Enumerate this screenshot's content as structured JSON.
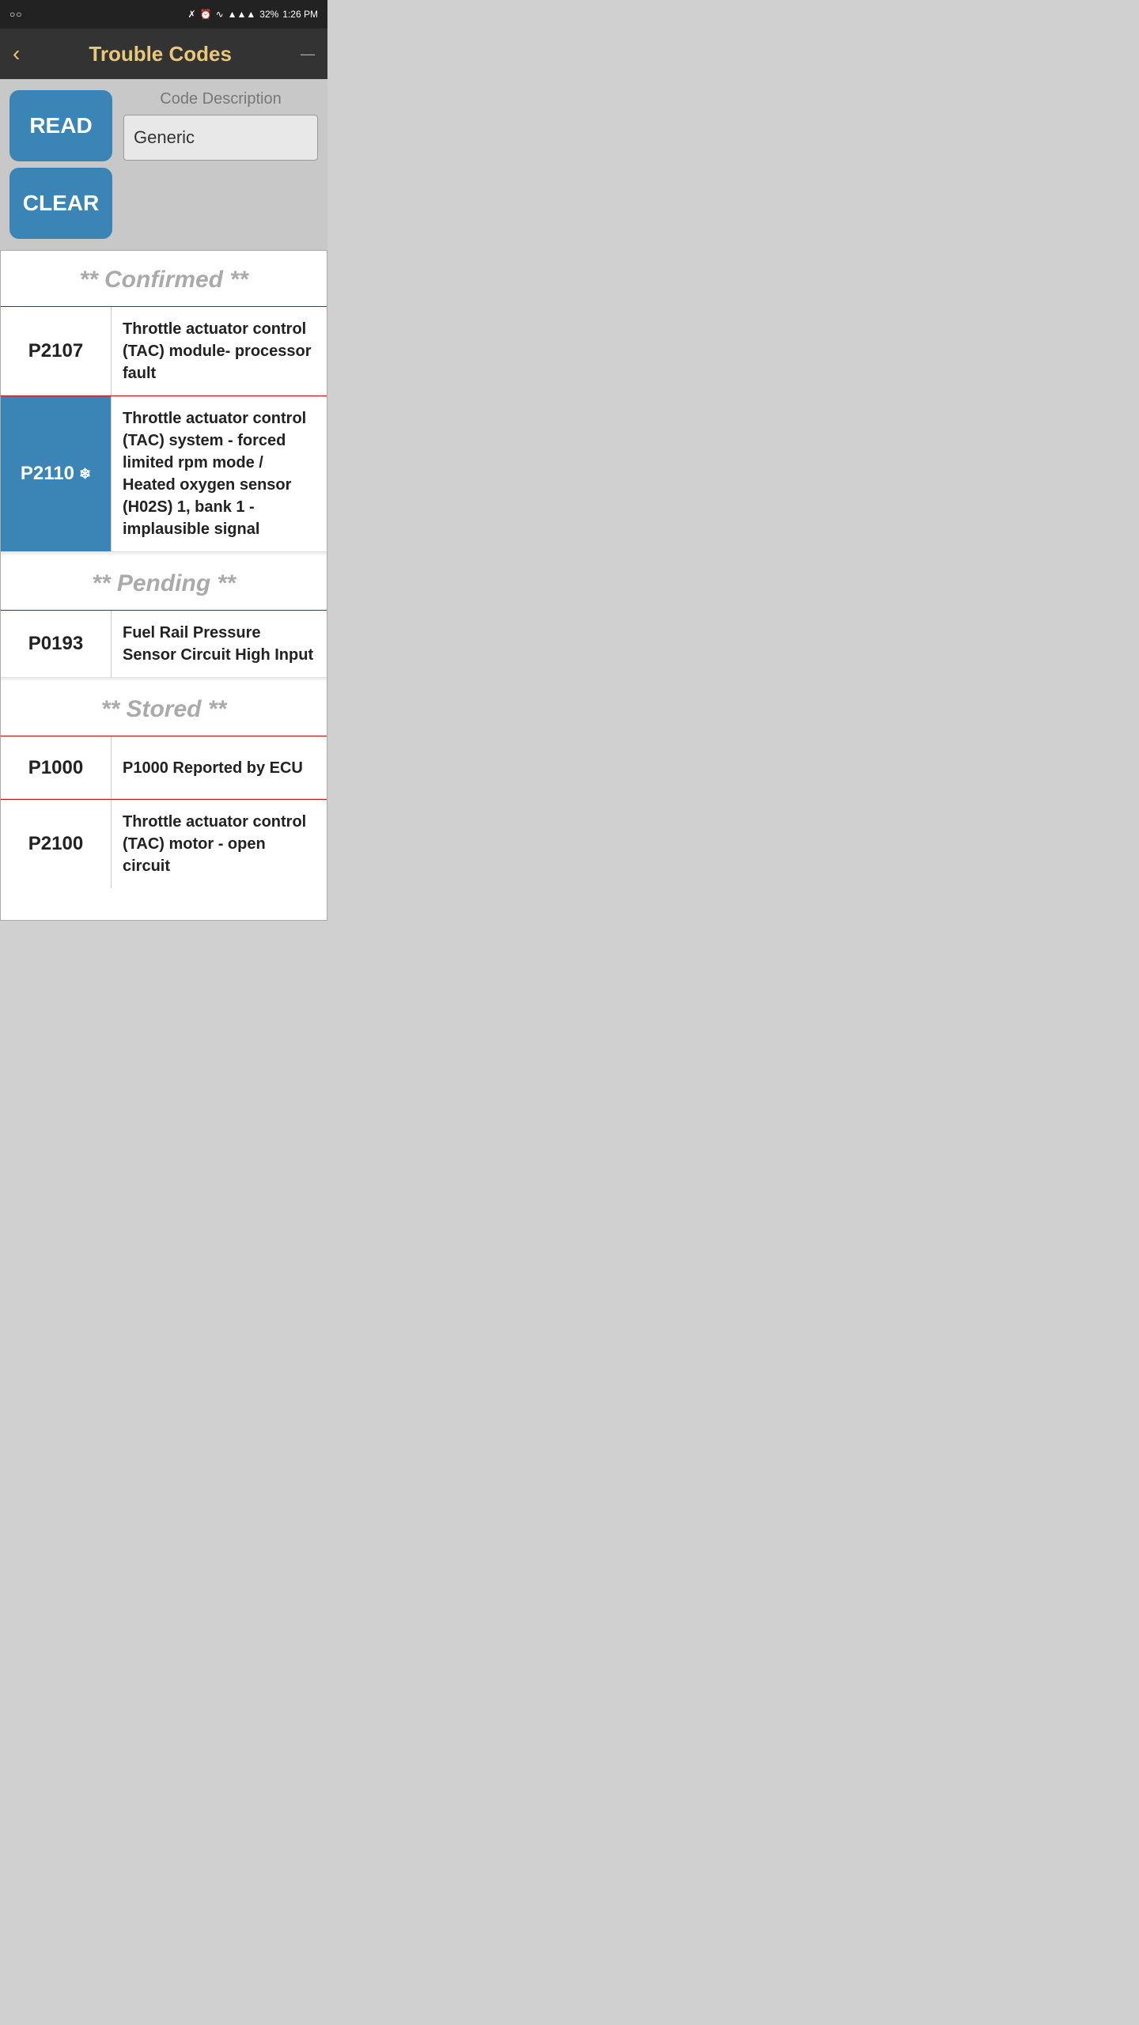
{
  "statusBar": {
    "leftIcon": "○○",
    "bluetooth": "⚇",
    "alarm": "⏰",
    "wifi": "WiFi",
    "signal": "▲▲▲",
    "battery": "32%",
    "time": "1:26 PM"
  },
  "header": {
    "backLabel": "‹",
    "title": "Trouble Codes",
    "menuLabel": "—"
  },
  "actionBar": {
    "readButton": "READ",
    "clearButton": "CLEAR",
    "codeDescLabel": "Code Description",
    "codeDescValue": "Generic"
  },
  "sections": [
    {
      "id": "confirmed",
      "header": "** Confirmed **",
      "rows": [
        {
          "code": "P2107",
          "highlighted": false,
          "showSnowflake": false,
          "description": "Throttle actuator control (TAC) module- processor fault"
        },
        {
          "code": "P2110",
          "highlighted": true,
          "showSnowflake": true,
          "description": "Throttle actuator control (TAC) system - forced limited rpm mode / Heated oxygen sensor (H02S) 1, bank 1 - implausible signal"
        }
      ]
    },
    {
      "id": "pending",
      "header": "** Pending **",
      "rows": [
        {
          "code": "P0193",
          "highlighted": false,
          "showSnowflake": false,
          "description": "Fuel Rail Pressure Sensor Circuit High Input"
        }
      ]
    },
    {
      "id": "stored",
      "header": "** Stored **",
      "rows": [
        {
          "code": "P1000",
          "highlighted": false,
          "showSnowflake": false,
          "description": "P1000 Reported by ECU"
        },
        {
          "code": "P2100",
          "highlighted": false,
          "showSnowflake": false,
          "description": "Throttle actuator control (TAC) motor - open circuit"
        }
      ]
    }
  ]
}
